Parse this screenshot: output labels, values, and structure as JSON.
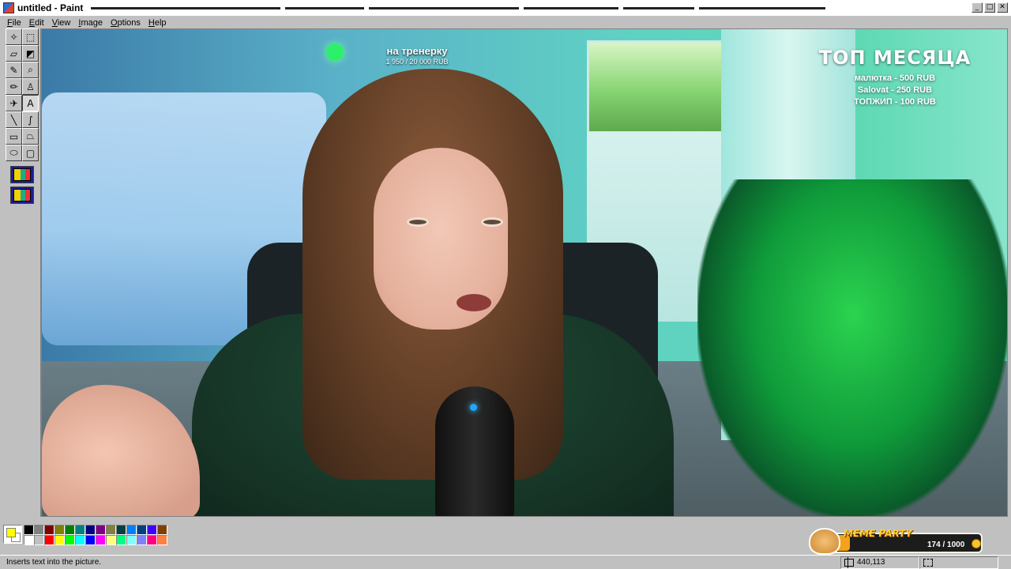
{
  "window": {
    "title": "untitled - Paint",
    "caption_buttons": [
      "_",
      "□",
      "✕"
    ]
  },
  "menu": {
    "items": [
      {
        "underline": "F",
        "rest": "ile"
      },
      {
        "underline": "E",
        "rest": "dit"
      },
      {
        "underline": "V",
        "rest": "iew"
      },
      {
        "underline": "I",
        "rest": "mage"
      },
      {
        "underline": "O",
        "rest": "ptions"
      },
      {
        "underline": "H",
        "rest": "elp"
      }
    ]
  },
  "tools": [
    {
      "name": "free-form-select-icon",
      "glyph": "✧"
    },
    {
      "name": "select-icon",
      "glyph": "⬚"
    },
    {
      "name": "eraser-icon",
      "glyph": "▱"
    },
    {
      "name": "fill-icon",
      "glyph": "◩"
    },
    {
      "name": "pick-color-icon",
      "glyph": "✎"
    },
    {
      "name": "magnifier-icon",
      "glyph": "⌕"
    },
    {
      "name": "pencil-icon",
      "glyph": "✏"
    },
    {
      "name": "brush-icon",
      "glyph": "♙"
    },
    {
      "name": "airbrush-icon",
      "glyph": "✈"
    },
    {
      "name": "text-icon",
      "glyph": "A"
    },
    {
      "name": "line-icon",
      "glyph": "╲"
    },
    {
      "name": "curve-icon",
      "glyph": "∫"
    },
    {
      "name": "rectangle-icon",
      "glyph": "▭"
    },
    {
      "name": "polygon-icon",
      "glyph": "⏢"
    },
    {
      "name": "ellipse-icon",
      "glyph": "⬭"
    },
    {
      "name": "rounded-rectangle-icon",
      "glyph": "▢"
    }
  ],
  "active_tool": "text-icon",
  "stream_overlay": {
    "goal_title": "на тренерку",
    "goal_progress": "1 950 / 20 000 RUB",
    "top_title": "ТОП МЕСЯЦА",
    "top_rows": [
      "малютка - 500 RUB",
      "Salovat - 250 RUB",
      "ТОПЖИП - 100 RUB"
    ]
  },
  "palette": {
    "foreground": "#ffff00",
    "background": "#ffffff",
    "colors": [
      "#000000",
      "#808080",
      "#800000",
      "#808000",
      "#008000",
      "#008080",
      "#000080",
      "#800080",
      "#808040",
      "#004040",
      "#0080ff",
      "#004080",
      "#4000ff",
      "#804000",
      "#ffffff",
      "#c0c0c0",
      "#ff0000",
      "#ffff00",
      "#00ff00",
      "#00ffff",
      "#0000ff",
      "#ff00ff",
      "#ffff80",
      "#00ff80",
      "#80ffff",
      "#8080ff",
      "#ff0080",
      "#ff8040"
    ]
  },
  "status": {
    "text": "Inserts text into the picture.",
    "coords": "440,113",
    "size": ""
  },
  "meme_party": {
    "title": "MEME PARTY",
    "count": "174 / 1000",
    "progress": 0.174
  }
}
